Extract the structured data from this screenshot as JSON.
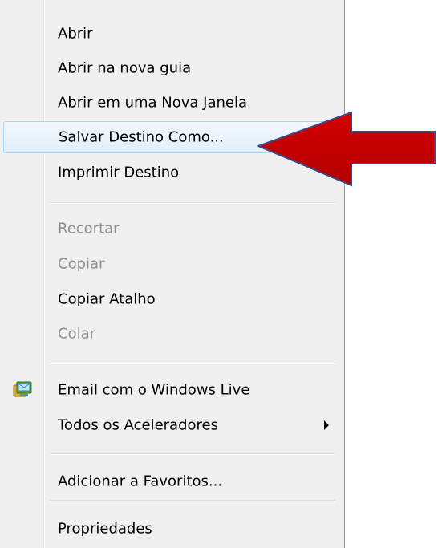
{
  "context_menu": {
    "items": [
      {
        "label": "Abrir",
        "enabled": true
      },
      {
        "label": "Abrir na nova guia",
        "enabled": true
      },
      {
        "label": "Abrir em uma Nova Janela",
        "enabled": true
      },
      {
        "label": "Salvar Destino Como...",
        "enabled": true,
        "highlighted": true
      },
      {
        "label": "Imprimir Destino",
        "enabled": true
      },
      {
        "label": "Recortar",
        "enabled": false
      },
      {
        "label": "Copiar",
        "enabled": false
      },
      {
        "label": "Copiar Atalho",
        "enabled": true
      },
      {
        "label": "Colar",
        "enabled": false
      },
      {
        "label": "Email com o Windows Live",
        "enabled": true,
        "icon": "windows-live-mail-icon"
      },
      {
        "label": "Todos os Aceleradores",
        "enabled": true,
        "submenu": true
      },
      {
        "label": "Adicionar a Favoritos...",
        "enabled": true
      },
      {
        "label": "Propriedades",
        "enabled": true
      }
    ]
  },
  "annotation": {
    "arrow_color": "#c00000",
    "arrow_outline": "#3a4a8a",
    "points_to": "Salvar Destino Como..."
  },
  "colors": {
    "menu_background": "#f0f0f0",
    "highlight_border": "#a8d8f8",
    "disabled_text": "#8d8d8d"
  }
}
